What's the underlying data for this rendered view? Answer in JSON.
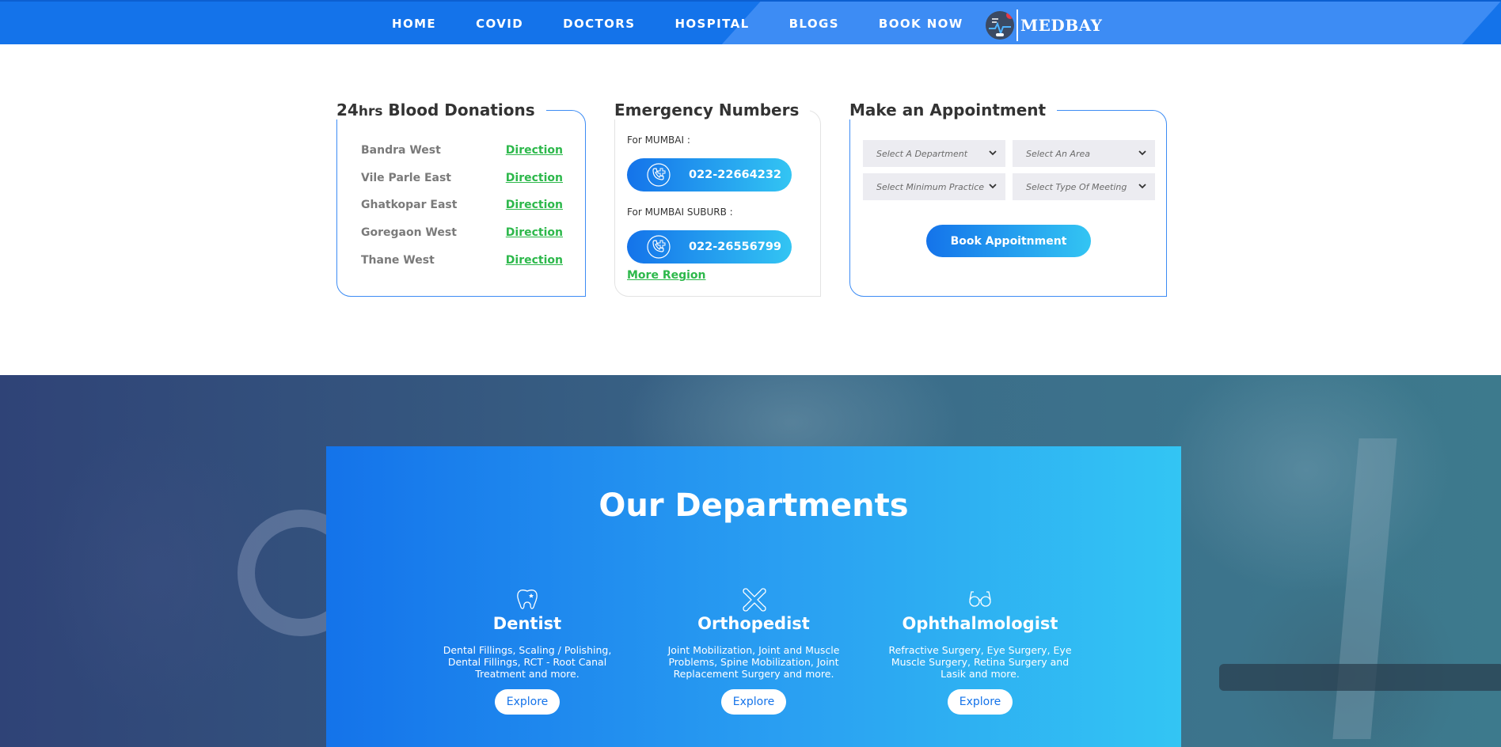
{
  "nav": {
    "items": [
      "HOME",
      "COVID",
      "DOCTORS",
      "HOSPITAL",
      "BLOGS",
      "BOOK NOW"
    ],
    "logo_text": "MEDBAY"
  },
  "blood": {
    "title_prefix": "24",
    "title_small": "hrs",
    "title_rest": " Blood Donations",
    "rows": [
      {
        "place": "Bandra West",
        "link": "Direction"
      },
      {
        "place": "Vile Parle East",
        "link": "Direction"
      },
      {
        "place": "Ghatkopar East",
        "link": "Direction"
      },
      {
        "place": "Goregaon West",
        "link": "Direction"
      },
      {
        "place": "Thane West",
        "link": "Direction"
      }
    ]
  },
  "emergency": {
    "title": "Emergency Numbers",
    "entries": [
      {
        "label": "For MUMBAI :",
        "number": "022-22664232"
      },
      {
        "label": "For MUMBAI SUBURB :",
        "number": "022-26556799"
      }
    ],
    "more": "More Region"
  },
  "appointment": {
    "title": "Make an Appointment",
    "selects": [
      "Select A Department",
      "Select An Area",
      "Select Minimum Practice",
      "Select Type Of Meeting"
    ],
    "button": "Book Appoitnment"
  },
  "departments": {
    "heading": "Our Departments",
    "items": [
      {
        "name": "Dentist",
        "icon": "tooth-icon",
        "desc": "Dental Fillings, Scaling / Polishing, Dental Fillings, RCT - Root Canal Treatment and more.",
        "button": "Explore"
      },
      {
        "name": "Orthopedist",
        "icon": "bone-icon",
        "desc": "Joint Mobilization, Joint and Muscle Problems, Spine Mobilization, Joint Replacement Surgery and more.",
        "button": "Explore"
      },
      {
        "name": "Ophthalmologist",
        "icon": "glasses-icon",
        "desc": "Refractive Surgery, Eye Surgery, Eye Muscle Surgery, Retina Surgery and Lasik and more.",
        "button": "Explore"
      }
    ]
  },
  "colors": {
    "primary": "#1473ea",
    "accent": "#33c5f3",
    "link_green": "#2db84b"
  }
}
